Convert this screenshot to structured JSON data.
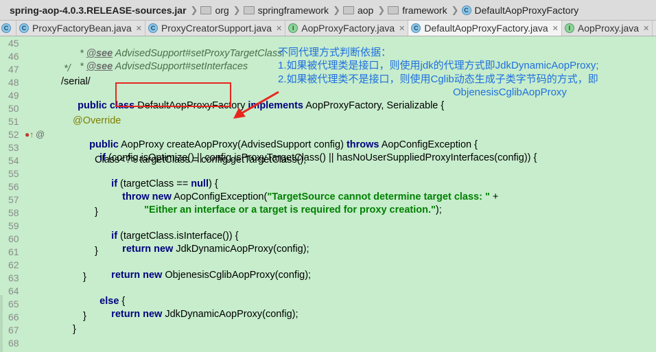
{
  "breadcrumb": {
    "jar": "spring-aop-4.0.3.RELEASE-sources.jar",
    "segments": [
      "org",
      "springframework",
      "aop",
      "framework"
    ],
    "current": "DefaultAopProxyFactory"
  },
  "tabs": [
    {
      "label": "ProxyFactoryBean.java",
      "kind": "class"
    },
    {
      "label": "ProxyCreatorSupport.java",
      "kind": "class"
    },
    {
      "label": "AopProxyFactory.java",
      "kind": "interface"
    },
    {
      "label": "DefaultAopProxyFactory.java",
      "kind": "class",
      "active": true
    },
    {
      "label": "AopProxy.java",
      "kind": "interface"
    }
  ],
  "editor": {
    "line_numbers": [
      "45",
      "46",
      "47",
      "48",
      "49",
      "50",
      "51",
      "52",
      "53",
      "54",
      "55",
      "56",
      "57",
      "58",
      "59",
      "60",
      "61",
      "62",
      "63",
      "64",
      "65",
      "66",
      "67",
      "68"
    ],
    "lines": {
      "l45_tag": "@see",
      "l45_text": " AdvisedSupport#setProxyTargetClass",
      "l46_tag": "@see",
      "l46_text": " AdvisedSupport#setInterfaces",
      "l47": "*/",
      "l48": "/serial/",
      "l49_kw1": "public class",
      "l49_name": "DefaultAopProxyFactory",
      "l49_kw2": "implements",
      "l49_rest": " AopProxyFactory, Serializable {",
      "l51": "@Override",
      "l52_kw": "public",
      "l52_mid": " AopProxy createAopProxy(AdvisedSupport config) ",
      "l52_kw2": "throws",
      "l52_rest": " AopConfigException {",
      "l53_kw": "if",
      "l53_rest": " (config.isOptimize() || config.isProxyTargetClass() || hasNoUserSuppliedProxyInterfaces(config)) {",
      "l54": "Class<?> targetClass = config.getTargetClass();",
      "l55_kw": "if",
      "l55_mid": " (targetClass == ",
      "l55_kw2": "null",
      "l55_rest": ") {",
      "l56_kw": "throw new",
      "l56_mid": " AopConfigException(",
      "l56_str": "\"TargetSource cannot determine target class: \"",
      "l56_rest": " +",
      "l57_str": "\"Either an interface or a target is required for proxy creation.\"",
      "l57_rest": ");",
      "l58": "}",
      "l59_kw": "if",
      "l59_rest": " (targetClass.isInterface()) {",
      "l60_kw": "return new",
      "l60_rest": " JdkDynamicAopProxy(config);",
      "l61": "}",
      "l62_kw": "return new",
      "l62_rest": " ObjenesisCglibAopProxy(config);",
      "l63": "}",
      "l64_kw": "else",
      "l64_rest": " {",
      "l65_kw": "return new",
      "l65_rest": " JdkDynamicAopProxy(config);",
      "l66": "}",
      "l67": "}"
    }
  },
  "annotation": {
    "line1": "不同代理方式判断依据：",
    "line2": "1.如果被代理类是接口，则使用jdk的代理方式即JdkDynamicAopProxy;",
    "line3": "2.如果被代理类不是接口，则使用Cglib动态生成子类字节码的方式，即",
    "line4": "ObjenesisCglibAopProxy",
    "box_color": "#e8261e",
    "text_color": "#1f6fe0"
  }
}
